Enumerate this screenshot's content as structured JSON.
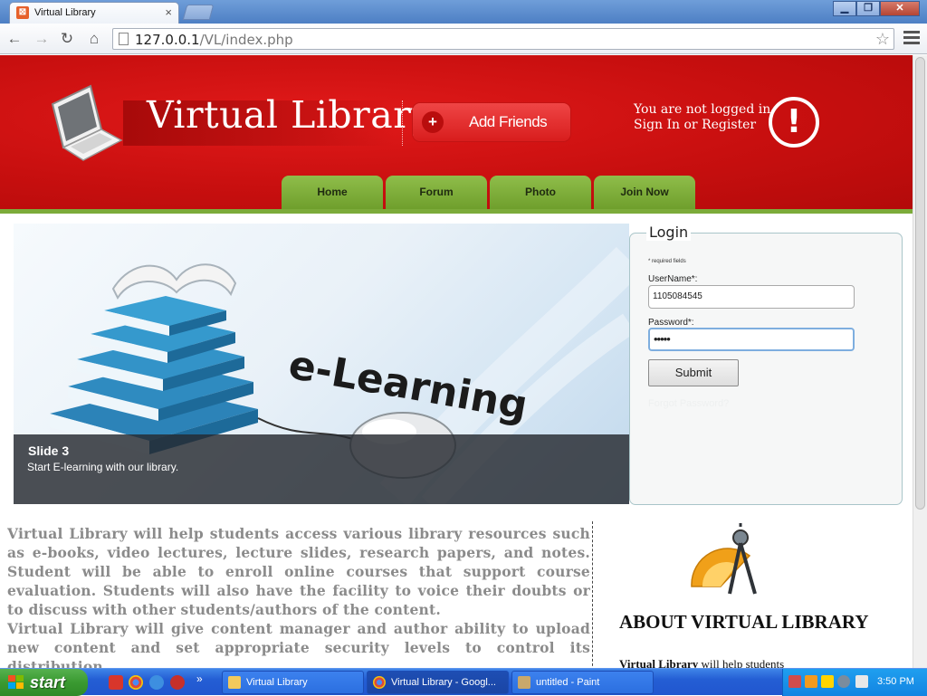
{
  "browser": {
    "tab_title": "Virtual Library",
    "tab_close": "×",
    "url_host": "127.0.0.1",
    "url_path": "/VL/index.php",
    "win_minimize": "▁",
    "win_restore": "❐",
    "win_close": "✕"
  },
  "site": {
    "logo_text": "Virtual Library",
    "add_friends_label": "Add Friends",
    "status_line1": "You are not logged in.",
    "status_line2": "Sign In or Register",
    "nav": [
      "Home",
      "Forum",
      "Photo",
      "Join Now"
    ]
  },
  "slider": {
    "image_text": "e-Learning",
    "title": "Slide 3",
    "text": "Start E-learning with our library."
  },
  "login": {
    "legend": "Login",
    "required_note": "* required fields",
    "username_label": "UserName*:",
    "username_value": "1105084545",
    "password_label": "Password*:",
    "password_value": "•••••",
    "submit_label": "Submit",
    "forgot_label": "Forgot Password?"
  },
  "content": {
    "paragraph1": "Virtual Library will help students access various library resources such as e-books, video lectures, lecture slides, research papers, and notes. Student will be able to enroll online courses that support course evaluation. Students will also have the facility to voice their doubts or to discuss with other students/authors of the content.",
    "paragraph2": "Virtual Library will give content manager and author ability to upload new content and set appropriate security levels to control its distribution.",
    "about_title": "ABOUT VIRTUAL LIBRARY",
    "about_text_bold": "Virtual Library",
    "about_text_rest": " will help students"
  },
  "taskbar": {
    "start_label": "start",
    "tasks": [
      "Virtual Library",
      "Virtual Library - Googl...",
      "untitled - Paint"
    ],
    "clock": "3:50 PM",
    "more": "»"
  },
  "colors": {
    "header_red": "#c80f0f",
    "nav_green": "#7cab3a",
    "taskbar_blue": "#245ed4"
  }
}
